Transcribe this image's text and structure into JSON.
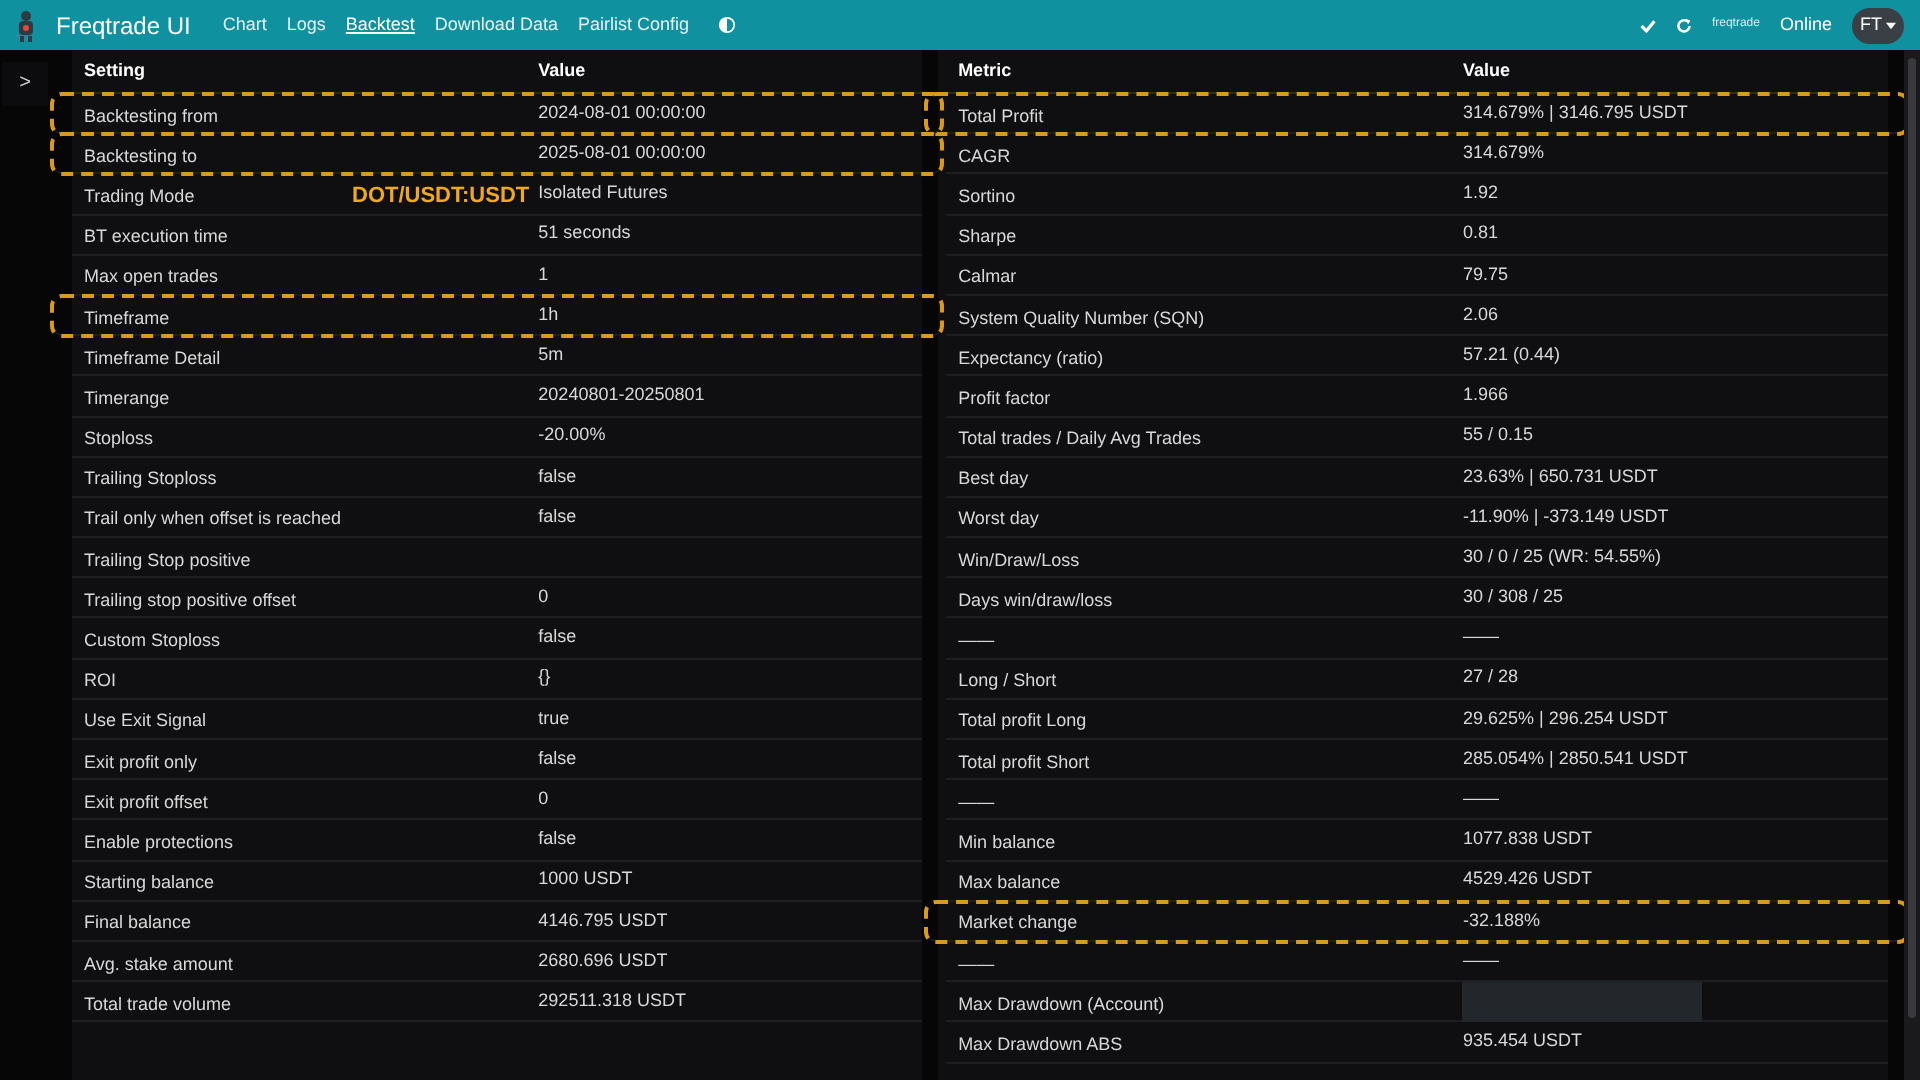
{
  "navbar": {
    "brand": "Freqtrade UI",
    "links": [
      {
        "label": "Chart",
        "selected": false
      },
      {
        "label": "Logs",
        "selected": false
      },
      {
        "label": "Backtest",
        "selected": true
      },
      {
        "label": "Download Data",
        "selected": false
      },
      {
        "label": "Pairlist Config",
        "selected": false
      }
    ],
    "bot_name": "freqtrade",
    "status": "Online",
    "avatar": "FT"
  },
  "sidebar_toggle": ">",
  "overlay_label": "DOT/USDT:USDT",
  "settings_table": {
    "columns": [
      "Setting",
      "Value"
    ],
    "rows": [
      {
        "setting": "Backtesting from",
        "value": "2024-08-01 00:00:00",
        "highlighted": true
      },
      {
        "setting": "Backtesting to",
        "value": "2025-08-01 00:00:00",
        "highlighted": true
      },
      {
        "setting": "Trading Mode",
        "value": "Isolated Futures",
        "highlighted": false
      },
      {
        "setting": "BT execution time",
        "value": "51 seconds",
        "highlighted": false
      },
      {
        "setting": "Max open trades",
        "value": "1",
        "highlighted": false
      },
      {
        "setting": "Timeframe",
        "value": "1h",
        "highlighted": true
      },
      {
        "setting": "Timeframe Detail",
        "value": "5m",
        "highlighted": false
      },
      {
        "setting": "Timerange",
        "value": "20240801-20250801",
        "highlighted": false
      },
      {
        "setting": "Stoploss",
        "value": "-20.00%",
        "highlighted": false
      },
      {
        "setting": "Trailing Stoploss",
        "value": "false",
        "highlighted": false
      },
      {
        "setting": "Trail only when offset is reached",
        "value": "false",
        "highlighted": false
      },
      {
        "setting": "Trailing Stop positive",
        "value": "",
        "highlighted": false
      },
      {
        "setting": "Trailing stop positive offset",
        "value": "0",
        "highlighted": false
      },
      {
        "setting": "Custom Stoploss",
        "value": "false",
        "highlighted": false
      },
      {
        "setting": "ROI",
        "value": "{}",
        "highlighted": false
      },
      {
        "setting": "Use Exit Signal",
        "value": "true",
        "highlighted": false
      },
      {
        "setting": "Exit profit only",
        "value": "false",
        "highlighted": false
      },
      {
        "setting": "Exit profit offset",
        "value": "0",
        "highlighted": false
      },
      {
        "setting": "Enable protections",
        "value": "false",
        "highlighted": false
      },
      {
        "setting": "Starting balance",
        "value": "1000 USDT",
        "highlighted": false
      },
      {
        "setting": "Final balance",
        "value": "4146.795 USDT",
        "highlighted": false
      },
      {
        "setting": "Avg. stake amount",
        "value": "2680.696 USDT",
        "highlighted": false
      },
      {
        "setting": "Total trade volume",
        "value": "292511.318 USDT",
        "highlighted": false
      }
    ]
  },
  "metrics_table": {
    "columns": [
      "Metric",
      "Value"
    ],
    "rows": [
      {
        "kind": "text",
        "metric": "Total Profit",
        "value": "314.679% | 3146.795 USDT",
        "highlighted": true
      },
      {
        "kind": "text",
        "metric": "CAGR",
        "value": "314.679%",
        "highlighted": false
      },
      {
        "kind": "text",
        "metric": "Sortino",
        "value": "1.92",
        "highlighted": false
      },
      {
        "kind": "text",
        "metric": "Sharpe",
        "value": "0.81",
        "highlighted": false
      },
      {
        "kind": "text",
        "metric": "Calmar",
        "value": "79.75",
        "highlighted": false
      },
      {
        "kind": "text",
        "metric": "System Quality Number (SQN)",
        "value": "2.06",
        "highlighted": false
      },
      {
        "kind": "text",
        "metric": "Expectancy (ratio)",
        "value": "57.21 (0.44)",
        "highlighted": false
      },
      {
        "kind": "text",
        "metric": "Profit factor",
        "value": "1.966",
        "highlighted": false
      },
      {
        "kind": "text",
        "metric": "Total trades / Daily Avg Trades",
        "value": "55 / 0.15",
        "highlighted": false
      },
      {
        "kind": "text",
        "metric": "Best day",
        "value": "23.63% | 650.731 USDT",
        "highlighted": false
      },
      {
        "kind": "text",
        "metric": "Worst day",
        "value": "-11.90% | -373.149 USDT",
        "highlighted": false
      },
      {
        "kind": "text",
        "metric": "Win/Draw/Loss",
        "value": "30 / 0 / 25 (WR: 54.55%)",
        "highlighted": false
      },
      {
        "kind": "text",
        "metric": "Days win/draw/loss",
        "value": "30 / 308 / 25",
        "highlighted": false
      },
      {
        "kind": "text",
        "metric": "——",
        "value": "——",
        "highlighted": false
      },
      {
        "kind": "text",
        "metric": "Long / Short",
        "value": "27 / 28",
        "highlighted": false
      },
      {
        "kind": "text",
        "metric": "Total profit Long",
        "value": "29.625% | 296.254 USDT",
        "highlighted": false
      },
      {
        "kind": "text",
        "metric": "Total profit Short",
        "value": "285.054% | 2850.541 USDT",
        "highlighted": false
      },
      {
        "kind": "text",
        "metric": "——",
        "value": "——",
        "highlighted": false
      },
      {
        "kind": "text",
        "metric": "Min balance",
        "value": "1077.838 USDT",
        "highlighted": false
      },
      {
        "kind": "text",
        "metric": "Max balance",
        "value": "4529.426 USDT",
        "highlighted": false
      },
      {
        "kind": "text",
        "metric": "Market change",
        "value": "-32.188%",
        "highlighted": true
      },
      {
        "kind": "text",
        "metric": "——",
        "value": "——",
        "highlighted": false
      },
      {
        "kind": "redacted",
        "metric": "Max Drawdown (Account)",
        "highlighted": false
      },
      {
        "kind": "text",
        "metric": "Max Drawdown ABS",
        "value": "935.454 USDT",
        "highlighted": false
      }
    ]
  }
}
